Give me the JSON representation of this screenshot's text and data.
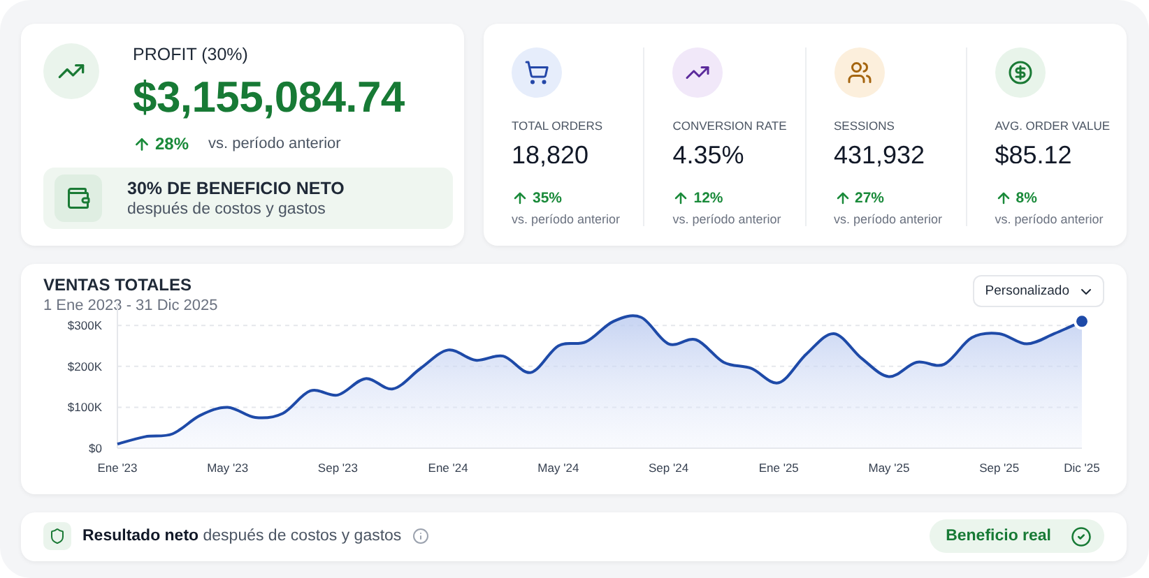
{
  "profit": {
    "label": "PROFIT (30%)",
    "amount": "$3,155,084.74",
    "change": "28%",
    "comparison": "vs. período anterior",
    "note": {
      "title": "30% DE BENEFICIO NETO",
      "subtitle": "después de costos y gastos"
    }
  },
  "metrics": [
    {
      "kind": "orders",
      "label": "TOTAL ORDERS",
      "value": "18,820",
      "change": "35%",
      "comparison": "vs. período anterior"
    },
    {
      "kind": "conversion",
      "label": "CONVERSION RATE",
      "value": "4.35%",
      "change": "12%",
      "comparison": "vs. período anterior"
    },
    {
      "kind": "sessions",
      "label": "SESSIONS",
      "value": "431,932",
      "change": "27%",
      "comparison": "vs. período anterior"
    },
    {
      "kind": "value",
      "label": "AVG. ORDER VALUE",
      "value": "$85.12",
      "change": "8%",
      "comparison": "vs. período anterior"
    }
  ],
  "sales": {
    "title": "VENTAS TOTALES",
    "range": "1 Ene 2023 - 31 Dic 2025",
    "period_select": {
      "value": "Personalizado"
    },
    "chart_data": {
      "type": "area",
      "categories": [
        "Ene '23",
        null,
        null,
        null,
        "May '23",
        null,
        null,
        null,
        "Sep '23",
        null,
        null,
        null,
        "Ene '24",
        null,
        null,
        null,
        "May '24",
        null,
        null,
        null,
        "Sep '24",
        null,
        null,
        null,
        "Ene '25",
        null,
        null,
        null,
        "May '25",
        null,
        null,
        null,
        "Sep '25",
        null,
        null,
        "Dic '25"
      ],
      "series": [
        {
          "color": "#1e4aa8",
          "values": [
            10,
            28,
            35,
            80,
            100,
            75,
            85,
            140,
            130,
            170,
            145,
            195,
            240,
            215,
            225,
            185,
            250,
            260,
            310,
            320,
            255,
            265,
            210,
            195,
            160,
            230,
            280,
            220,
            175,
            210,
            205,
            270,
            280,
            255,
            280,
            310
          ]
        }
      ],
      "ylim": [
        0,
        355
      ],
      "grid": true,
      "yticks": [
        {
          "value": 0,
          "label": "$0"
        },
        {
          "value": 100,
          "label": "$100K"
        },
        {
          "value": 200,
          "label": "$200K"
        },
        {
          "value": 300,
          "label": "$300K"
        }
      ]
    }
  },
  "footer": {
    "text": "**Resultado neto** después de costos y gastos",
    "badge": "Beneficio real"
  }
}
